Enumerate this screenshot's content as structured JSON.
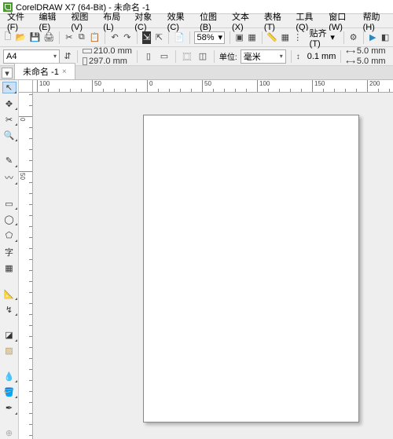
{
  "title": "CorelDRAW X7 (64-Bit) - 未命名 -1",
  "menu": {
    "file": "文件(F)",
    "edit": "编辑(E)",
    "view": "视图(V)",
    "layout": "布局(L)",
    "object": "对象(C)",
    "effect": "效果(C)",
    "bitmap": "位图(B)",
    "text": "文本(X)",
    "table": "表格(T)",
    "tool": "工具(Q)",
    "window": "窗口(W)",
    "help": "帮助(H)"
  },
  "toolbar": {
    "zoom": "58%",
    "snap": "贴齐(T)",
    "unit_label": "单位:",
    "unit_val": "毫米",
    "nudge": "0.1 mm",
    "dup_x": "5.0 mm",
    "dup_y": "5.0 mm"
  },
  "prop": {
    "paper": "A4",
    "w": "210.0 mm",
    "h": "297.0 mm"
  },
  "doc": {
    "tab": "未命名 -1"
  },
  "ruler": {
    "h": [
      "100",
      "50",
      "0",
      "50",
      "100",
      "150",
      "200"
    ],
    "v": [
      "0",
      "50"
    ]
  }
}
